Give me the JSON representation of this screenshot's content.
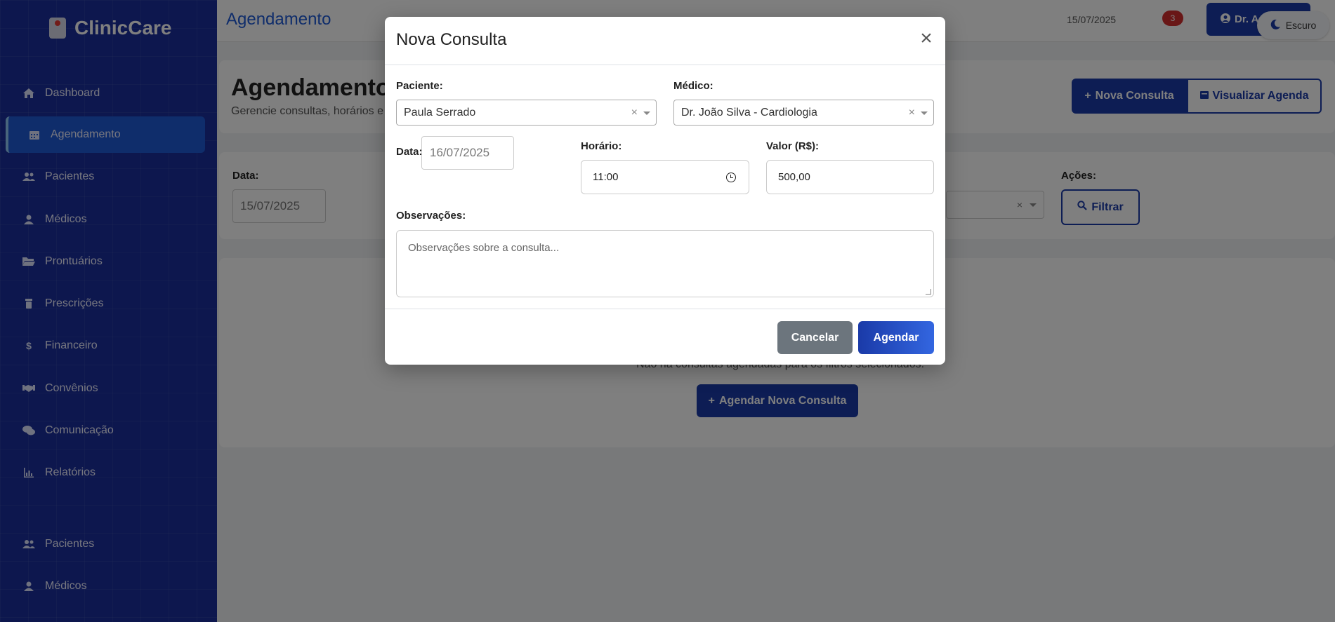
{
  "app": {
    "name": "ClinicCare"
  },
  "sidebar": {
    "items": [
      {
        "label": "Dashboard",
        "icon": "home-icon"
      },
      {
        "label": "Agendamento",
        "icon": "calendar-icon",
        "active": true
      },
      {
        "label": "Pacientes",
        "icon": "users-icon"
      },
      {
        "label": "Médicos",
        "icon": "user-icon"
      },
      {
        "label": "Prontuários",
        "icon": "folder-icon"
      },
      {
        "label": "Prescrições",
        "icon": "prescription-icon"
      },
      {
        "label": "Financeiro",
        "icon": "dollar-icon"
      },
      {
        "label": "Convênios",
        "icon": "handshake-icon"
      },
      {
        "label": "Comunicação",
        "icon": "comments-icon"
      },
      {
        "label": "Relatórios",
        "icon": "chart-icon"
      },
      {
        "label": "Pacientes",
        "icon": "users-icon"
      },
      {
        "label": "Médicos",
        "icon": "user-icon"
      }
    ]
  },
  "topbar": {
    "title": "Agendamento",
    "date": "15/07/2025",
    "notification_count": "3",
    "user_label": "Dr. A",
    "theme_label": "Escuro"
  },
  "page": {
    "title": "Agendamento d",
    "subtitle": "Gerencie consultas, horários e c",
    "new_button": "Nova Consulta",
    "view_button": "Visualizar Agenda"
  },
  "filters": {
    "date_label": "Data:",
    "date_value": "15/07/2025",
    "actions_label": "Ações:",
    "filter_button": "Filtrar"
  },
  "empty_state": {
    "message": "Não há consultas agendadas para os filtros selecionados.",
    "button": "Agendar Nova Consulta"
  },
  "modal": {
    "title": "Nova Consulta",
    "patient_label": "Paciente:",
    "patient_value": "Paula Serrado",
    "doctor_label": "Médico:",
    "doctor_value": "Dr. João Silva - Cardiologia",
    "date_label": "Data:",
    "date_value": "16/07/2025",
    "time_label": "Horário:",
    "time_value": "11:00",
    "value_label": "Valor (R$):",
    "value_value": "500,00",
    "notes_label": "Observações:",
    "notes_placeholder": "Observações sobre a consulta...",
    "cancel_button": "Cancelar",
    "submit_button": "Agendar"
  },
  "colors": {
    "sidebar_bg": "#1a2f9c",
    "primary": "#1a3aa8",
    "active_item": "#1f5bd6",
    "badge": "#d32f2f",
    "cancel": "#6c757d"
  }
}
